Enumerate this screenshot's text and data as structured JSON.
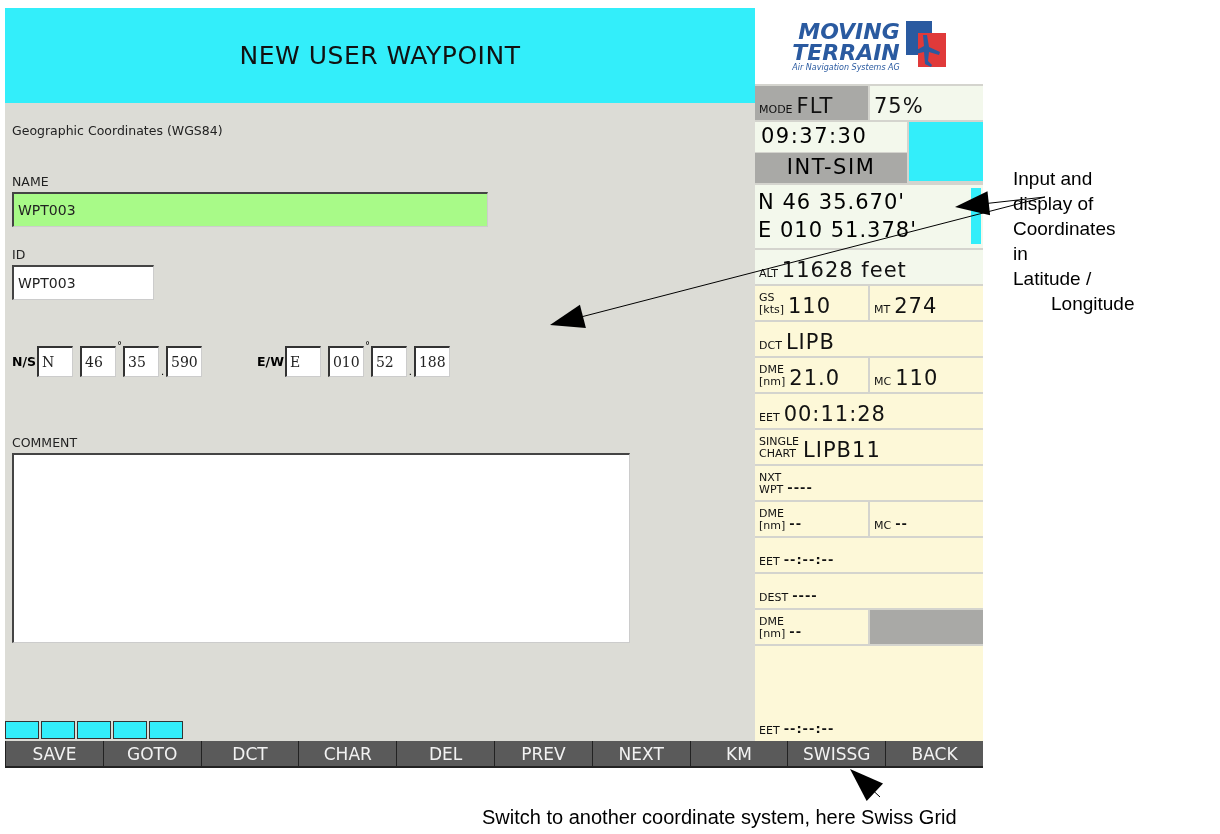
{
  "header": {
    "title": "NEW USER WAYPOINT"
  },
  "form": {
    "subtitle": "Geographic Coordinates (WGS84)",
    "fields": [
      {
        "label": "NAME",
        "value": "WPT003",
        "selected": true,
        "kind": "wide"
      },
      {
        "label": "ID",
        "value": "WPT003",
        "selected": false,
        "kind": "short"
      }
    ],
    "coordinates": [
      {
        "label": "N/S",
        "parts": [
          {
            "value": "N"
          },
          {
            "value": "46",
            "mark": "°"
          },
          {
            "value": "35",
            "mark": "."
          },
          {
            "value": "590"
          }
        ]
      },
      {
        "label": "E/W",
        "parts": [
          {
            "value": "E"
          },
          {
            "value": "010",
            "mark": "°"
          },
          {
            "value": "52",
            "mark": "."
          },
          {
            "value": "188"
          }
        ]
      }
    ],
    "comment": {
      "label": "COMMENT"
    }
  },
  "function_keys": [
    "SAVE",
    "GOTO",
    "DCT",
    "CHAR",
    "DEL",
    "PREV",
    "NEXT",
    "KM",
    "SWISSG",
    "BACK"
  ],
  "status_panel": {
    "logo": {
      "line1": "MOVING",
      "line2": "TERRAIN",
      "tagline": "Air Navigation Systems AG"
    },
    "rows": [
      {
        "kind": "cells",
        "cells": [
          {
            "label": [
              "MODE"
            ],
            "value": "FLT",
            "shaded": true,
            "kind": "big"
          },
          {
            "value": "75%",
            "shaded": false,
            "kind": "big"
          }
        ]
      },
      {
        "kind": "clock",
        "time": "09:37:30",
        "source": "INT-SIM"
      },
      {
        "kind": "coords",
        "lines": [
          "N 46 35.670'",
          "E 010 51.378'"
        ]
      },
      {
        "kind": "cells",
        "cells": [
          {
            "label": [
              "ALT"
            ],
            "value": "11628 feet",
            "shaded": false,
            "kind": "big"
          }
        ]
      },
      {
        "kind": "cells",
        "cells": [
          {
            "label": [
              "GS",
              "[kts]"
            ],
            "value": "110",
            "shaded": false,
            "kind": "big"
          },
          {
            "label": [
              "MT"
            ],
            "value": "274",
            "shaded": false,
            "kind": "big"
          }
        ]
      },
      {
        "kind": "cells",
        "cells": [
          {
            "label": [
              "DCT"
            ],
            "value": "LIPB",
            "shaded": false,
            "kind": "big"
          }
        ]
      },
      {
        "kind": "cells",
        "cells": [
          {
            "label": [
              "DME",
              "[nm]"
            ],
            "value": "21.0",
            "shaded": false,
            "kind": "big"
          },
          {
            "label": [
              "MC"
            ],
            "value": "110",
            "shaded": false,
            "kind": "big"
          }
        ]
      },
      {
        "kind": "cells",
        "cells": [
          {
            "label": [
              "EET"
            ],
            "value": "00:11:28",
            "shaded": false,
            "kind": "big"
          }
        ]
      },
      {
        "kind": "cells",
        "cells": [
          {
            "label": [
              "SINGLE",
              "CHART"
            ],
            "value": "LIPB11",
            "shaded": false,
            "kind": "big"
          }
        ]
      },
      {
        "kind": "cells",
        "cells": [
          {
            "label": [
              "NXT",
              "WPT"
            ],
            "value": "----",
            "shaded": false,
            "kind": "small"
          }
        ]
      },
      {
        "kind": "cells",
        "cells": [
          {
            "label": [
              "DME",
              "[nm]"
            ],
            "value": "--",
            "shaded": false,
            "kind": "small"
          },
          {
            "label": [
              "MC"
            ],
            "value": "--",
            "shaded": false,
            "kind": "small"
          }
        ]
      },
      {
        "kind": "cells",
        "cells": [
          {
            "label": [
              "EET"
            ],
            "value": "--:--:--",
            "shaded": false,
            "kind": "small"
          }
        ]
      },
      {
        "kind": "cells",
        "cells": [
          {
            "label": [
              "DEST"
            ],
            "value": "----",
            "shaded": false,
            "kind": "small"
          }
        ]
      },
      {
        "kind": "cells",
        "cells": [
          {
            "label": [
              "DME",
              "[nm]"
            ],
            "value": "--",
            "shaded": false,
            "kind": "small"
          },
          {
            "shaded": true
          }
        ]
      },
      {
        "kind": "cells",
        "cells": [
          {
            "label": [
              "EET"
            ],
            "value": "--:--:--",
            "shaded": false,
            "kind": "small"
          }
        ]
      }
    ]
  },
  "annotations": {
    "note_lines": [
      "Input and",
      "display of",
      "Coordinates",
      "in",
      "Latitude /",
      "Longitude"
    ],
    "caption": "Switch to another coordinate system, here Swiss Grid"
  }
}
